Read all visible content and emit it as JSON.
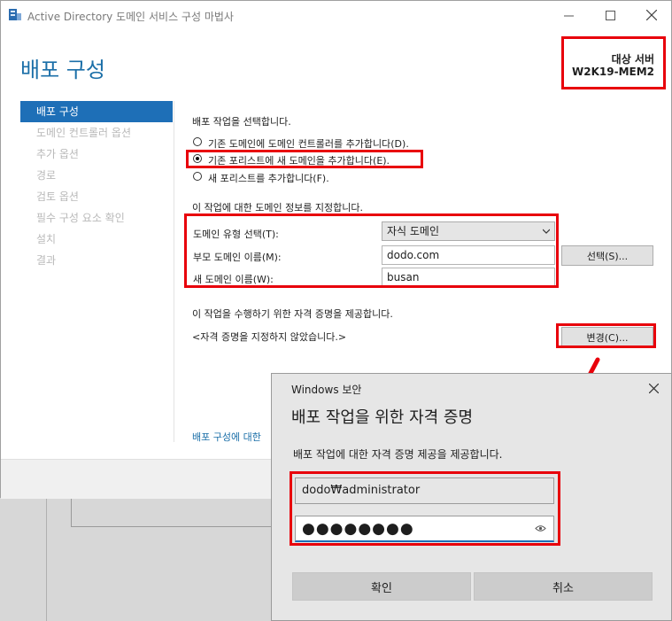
{
  "window": {
    "title": "Active Directory 도메인 서비스 구성 마법사",
    "page_title": "배포 구성",
    "target_label": "대상 서버",
    "target_server": "W2K19-MEM2"
  },
  "nav": {
    "items": [
      {
        "label": "배포 구성",
        "active": true
      },
      {
        "label": "도메인 컨트롤러 옵션",
        "active": false
      },
      {
        "label": "추가 옵션",
        "active": false
      },
      {
        "label": "경로",
        "active": false
      },
      {
        "label": "검토 옵션",
        "active": false
      },
      {
        "label": "필수 구성 요소 확인",
        "active": false
      },
      {
        "label": "설치",
        "active": false
      },
      {
        "label": "결과",
        "active": false
      }
    ]
  },
  "deployment": {
    "heading": "배포 작업을 선택합니다.",
    "options": [
      {
        "label": "기존 도메인에 도메인 컨트롤러를 추가합니다(D).",
        "selected": false
      },
      {
        "label": "기존 포리스트에 새 도메인을 추가합니다(E).",
        "selected": true
      },
      {
        "label": "새 포리스트를 추가합니다(F).",
        "selected": false
      }
    ]
  },
  "domain_info": {
    "heading": "이 작업에 대한 도메인 정보를 지정합니다.",
    "type_label": "도메인 유형 선택(T):",
    "type_value": "자식 도메인",
    "parent_label": "부모 도메인 이름(M):",
    "parent_value": "dodo.com",
    "new_label": "새 도메인 이름(W):",
    "new_value": "busan",
    "select_button": "선택(S)..."
  },
  "credentials": {
    "heading": "이 작업을 수행하기 위한 자격 증명을 제공합니다.",
    "status": "<자격 증명을 지정하지 않았습니다.>",
    "change_button": "변경(C)..."
  },
  "more_link": "배포 구성에 대한",
  "dialog": {
    "caption": "Windows 보안",
    "title": "배포 작업을 위한 자격 증명",
    "description": "배포 작업에 대한 자격 증명 제공을 제공합니다.",
    "username": "dodo₩administrator",
    "password_mask": "●●●●●●●●",
    "ok_button": "확인",
    "cancel_button": "취소"
  },
  "colors": {
    "accent": "#1e6fb7",
    "title_blue": "#1b6fa8",
    "annotation_red": "#e8000b"
  }
}
